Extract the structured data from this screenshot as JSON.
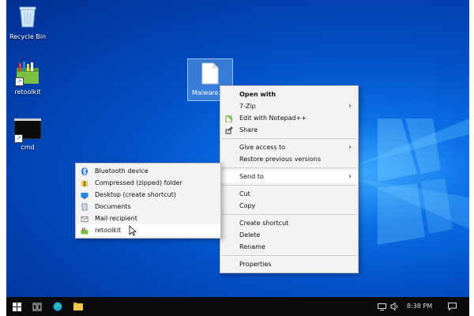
{
  "desktop": {
    "icons": [
      {
        "label": "Recycle Bin"
      },
      {
        "label": "retoolkit"
      },
      {
        "label": "cmd"
      },
      {
        "label": "Malware.e"
      }
    ]
  },
  "context_menu": {
    "items": [
      {
        "label": "Open with",
        "bold": true
      },
      {
        "label": "7-Zip",
        "submenu": true
      },
      {
        "label": "Edit with Notepad++",
        "icon": "notepadpp-icon"
      },
      {
        "label": "Share",
        "icon": "share-icon"
      },
      {
        "label": "Give access to",
        "submenu": true
      },
      {
        "label": "Restore previous versions"
      },
      {
        "label": "Send to",
        "submenu": true,
        "highlighted": true
      },
      {
        "label": "Cut"
      },
      {
        "label": "Copy"
      },
      {
        "label": "Create shortcut"
      },
      {
        "label": "Delete"
      },
      {
        "label": "Rename"
      },
      {
        "label": "Properties"
      }
    ]
  },
  "send_to_menu": {
    "items": [
      {
        "label": "Bluetooth device",
        "icon": "bluetooth-icon"
      },
      {
        "label": "Compressed (zipped) folder",
        "icon": "zip-folder-icon"
      },
      {
        "label": "Desktop (create shortcut)",
        "icon": "desktop-icon"
      },
      {
        "label": "Documents",
        "icon": "documents-icon"
      },
      {
        "label": "Mail recipient",
        "icon": "mail-icon"
      },
      {
        "label": "retoolkit",
        "icon": "retoolkit-icon",
        "highlighted": true
      }
    ]
  },
  "taskbar": {
    "time": "8:38 PM"
  },
  "colors": {
    "wallpaper": "#0350c7",
    "taskbar": "#0b0b0b",
    "menu_bg": "#f2f2f2",
    "menu_highlight": "#ffffff"
  }
}
